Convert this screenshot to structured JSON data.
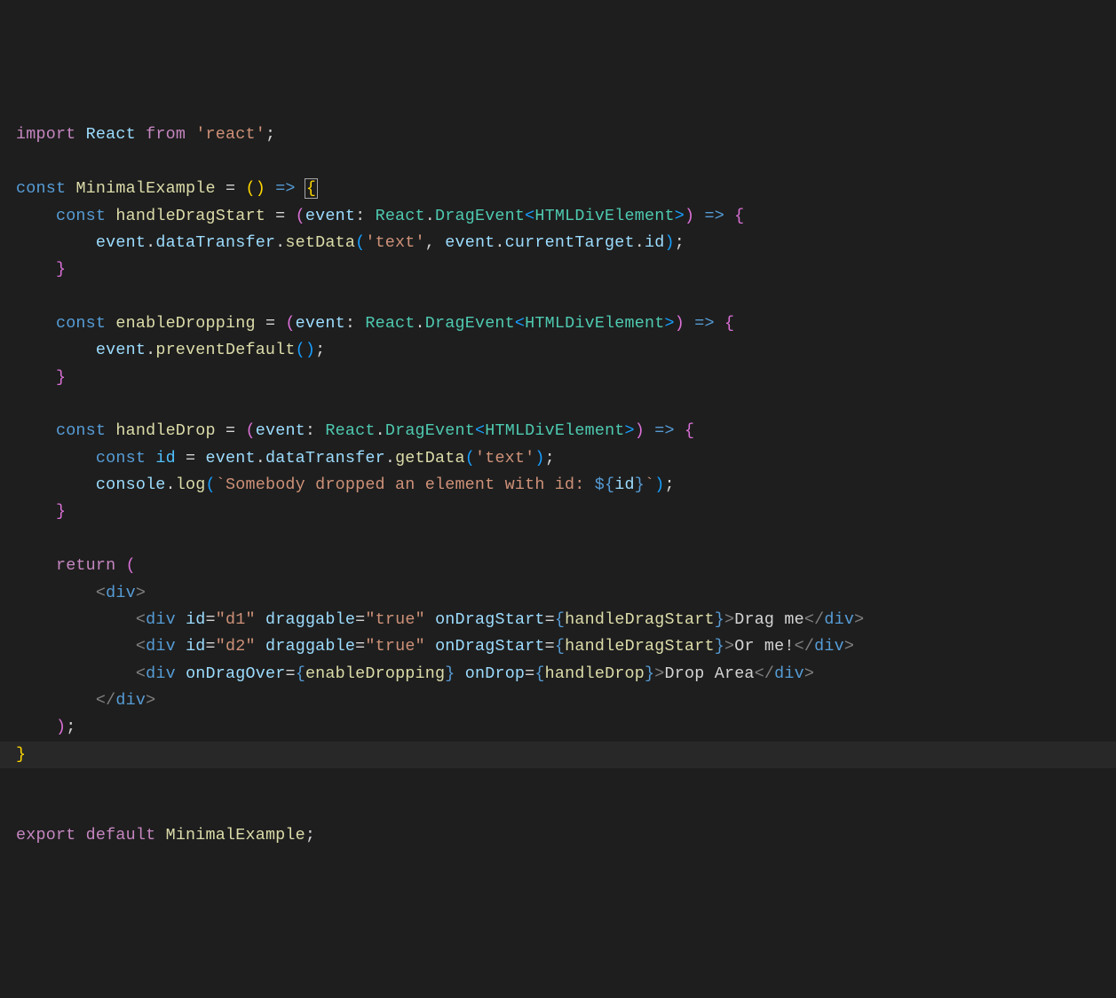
{
  "code": {
    "l1": {
      "import": "import",
      "react_ident": "React",
      "from": "from",
      "react_str": "'react'",
      "semi": ";"
    },
    "l3": {
      "const": "const",
      "name": "MinimalExample",
      "eq": " = ",
      "parens": "()",
      "arrow": " => ",
      "brace": "{"
    },
    "l4": {
      "const": "const",
      "name": "handleDragStart",
      "eq": " = ",
      "lp": "(",
      "param": "event",
      "colon": ": ",
      "ns": "React",
      "dot": ".",
      "type": "DragEvent",
      "lt": "<",
      "inner": "HTMLDivElement",
      "gt": ">",
      "rp": ")",
      "arrow": " => ",
      "brace": "{"
    },
    "l5": {
      "obj": "event",
      "d1": ".",
      "p1": "dataTransfer",
      "d2": ".",
      "fn": "setData",
      "lp": "(",
      "s1": "'text'",
      "comma": ", ",
      "obj2": "event",
      "d3": ".",
      "p2": "currentTarget",
      "d4": ".",
      "p3": "id",
      "rp": ")",
      "semi": ";"
    },
    "l6": {
      "brace": "}"
    },
    "l8": {
      "const": "const",
      "name": "enableDropping",
      "eq": " = ",
      "lp": "(",
      "param": "event",
      "colon": ": ",
      "ns": "React",
      "dot": ".",
      "type": "DragEvent",
      "lt": "<",
      "inner": "HTMLDivElement",
      "gt": ">",
      "rp": ")",
      "arrow": " => ",
      "brace": "{"
    },
    "l9": {
      "obj": "event",
      "d1": ".",
      "fn": "preventDefault",
      "lp": "(",
      "rp": ")",
      "semi": ";"
    },
    "l10": {
      "brace": "}"
    },
    "l12": {
      "const": "const",
      "name": "handleDrop",
      "eq": " = ",
      "lp": "(",
      "param": "event",
      "colon": ": ",
      "ns": "React",
      "dot": ".",
      "type": "DragEvent",
      "lt": "<",
      "inner": "HTMLDivElement",
      "gt": ">",
      "rp": ")",
      "arrow": " => ",
      "brace": "{"
    },
    "l13": {
      "const": "const",
      "name": "id",
      "eq": " = ",
      "obj": "event",
      "d1": ".",
      "p1": "dataTransfer",
      "d2": ".",
      "fn": "getData",
      "lp": "(",
      "s1": "'text'",
      "rp": ")",
      "semi": ";"
    },
    "l14": {
      "obj": "console",
      "d1": ".",
      "fn": "log",
      "lp": "(",
      "bt1": "`",
      "tpl_text": "Somebody dropped an element with id: ",
      "tpl_open": "${",
      "tpl_var": "id",
      "tpl_close": "}",
      "bt2": "`",
      "rp": ")",
      "semi": ";"
    },
    "l15": {
      "brace": "}"
    },
    "l17": {
      "return": "return",
      "lp": " ("
    },
    "l18": {
      "lt": "<",
      "tag": "div",
      "gt": ">"
    },
    "l19": {
      "lt": "<",
      "tag": "div",
      "sp": " ",
      "a1": "id",
      "eq1": "=",
      "v1": "\"d1\"",
      "sp2": " ",
      "a2": "draggable",
      "eq2": "=",
      "v2": "\"true\"",
      "sp3": " ",
      "a3": "onDragStart",
      "eq3": "=",
      "bo": "{",
      "hv": "handleDragStart",
      "bc": "}",
      "gt": ">",
      "text": "Drag me",
      "clt": "</",
      "ctag": "div",
      "cgt": ">"
    },
    "l20": {
      "lt": "<",
      "tag": "div",
      "sp": " ",
      "a1": "id",
      "eq1": "=",
      "v1": "\"d2\"",
      "sp2": " ",
      "a2": "draggable",
      "eq2": "=",
      "v2": "\"true\"",
      "sp3": " ",
      "a3": "onDragStart",
      "eq3": "=",
      "bo": "{",
      "hv": "handleDragStart",
      "bc": "}",
      "gt": ">",
      "text": "Or me!",
      "clt": "</",
      "ctag": "div",
      "cgt": ">"
    },
    "l21": {
      "lt": "<",
      "tag": "div",
      "sp": " ",
      "a1": "onDragOver",
      "eq1": "=",
      "bo1": "{",
      "hv1": "enableDropping",
      "bc1": "}",
      "sp2": " ",
      "a2": "onDrop",
      "eq2": "=",
      "bo2": "{",
      "hv2": "handleDrop",
      "bc2": "}",
      "gt": ">",
      "text": "Drop Area",
      "clt": "</",
      "ctag": "div",
      "cgt": ">"
    },
    "l22": {
      "clt": "</",
      "tag": "div",
      "gt": ">"
    },
    "l23": {
      "rp": ")",
      "semi": ";"
    },
    "l24": {
      "brace": "}"
    },
    "l26": {
      "export": "export",
      "default": "default",
      "name": "MinimalExample",
      "semi": ";"
    }
  }
}
